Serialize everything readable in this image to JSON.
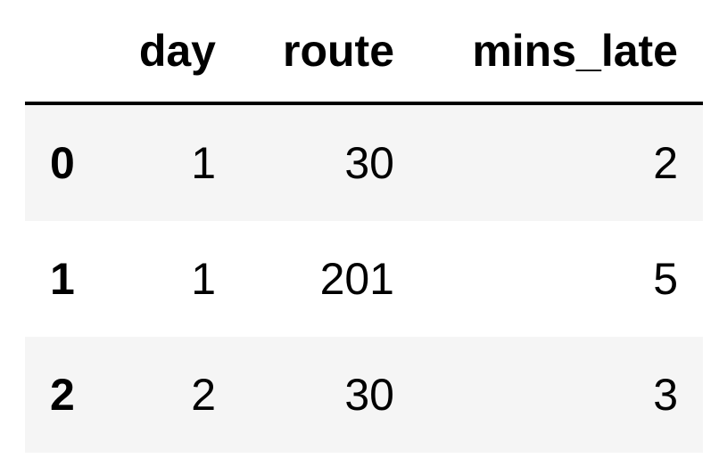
{
  "table": {
    "index_header": "",
    "columns": [
      "day",
      "route",
      "mins_late"
    ],
    "rows": [
      {
        "index": "0",
        "day": "1",
        "route": "30",
        "mins_late": "2"
      },
      {
        "index": "1",
        "day": "1",
        "route": "201",
        "mins_late": "5"
      },
      {
        "index": "2",
        "day": "2",
        "route": "30",
        "mins_late": "3"
      }
    ]
  },
  "colors": {
    "stripe": "#f5f5f5",
    "text": "#000000",
    "header_rule": "#000000"
  }
}
